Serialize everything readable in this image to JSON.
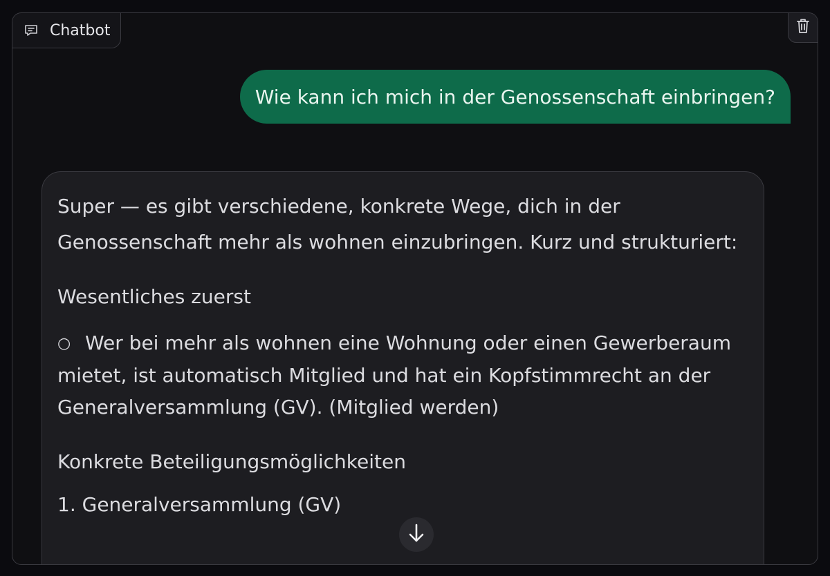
{
  "panel": {
    "label": "Chatbot",
    "label_icon": "chat-icon",
    "clear_icon": "trash-icon"
  },
  "messages": {
    "user": {
      "text": "Wie kann ich mich in der Genossenschaft einbringen?"
    },
    "bot": {
      "intro": "Super — es gibt verschiedene, konkrete Wege, dich in der Genossenschaft mehr als wohnen einzubringen. Kurz und strukturiert:",
      "heading_1": "Wesentliches zuerst",
      "bullet_marker": "○",
      "bullet_1": "Wer bei mehr als wohnen eine Wohnung oder einen Gewerberaum mietet, ist automatisch Mitglied und hat ein Kopfstimmrecht an der Generalversammlung (GV). (Mitglied werden)",
      "heading_2": "Konkrete Beteiligungsmöglichkeiten",
      "item_1": "1. Generalversammlung (GV)"
    }
  },
  "scroll_button": {
    "icon": "arrow-down-icon"
  },
  "colors": {
    "user_bubble": "#0e6b4a",
    "bot_bubble": "#1d1d21",
    "background": "#0f0f12"
  }
}
